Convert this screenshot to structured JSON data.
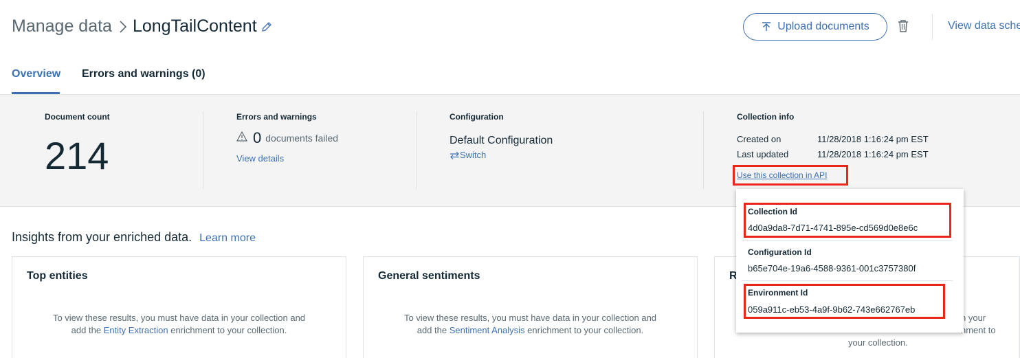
{
  "header": {
    "breadcrumb_root": "Manage data",
    "collection_name": "LongTailContent",
    "upload_label": "Upload documents",
    "view_schema_label": "View data sche"
  },
  "tabs": [
    {
      "label": "Overview",
      "active": true
    },
    {
      "label": "Errors and warnings (0)",
      "active": false
    }
  ],
  "summary": {
    "document_count_label": "Document count",
    "document_count": "214",
    "errors_label": "Errors and warnings",
    "errors_count": "0",
    "errors_text": "documents failed",
    "view_details": "View details",
    "configuration_label": "Configuration",
    "configuration_name": "Default Configuration",
    "switch_label": "Switch",
    "collection_info_label": "Collection info",
    "created_on_label": "Created on",
    "created_on": "11/28/2018 1:16:24 pm EST",
    "last_updated_label": "Last updated",
    "last_updated": "11/28/2018 1:16:24 pm EST",
    "api_link": "Use this collection in API"
  },
  "insights": {
    "title": "Insights from your enriched data.",
    "learn_more": "Learn more",
    "cards": [
      {
        "title": "Top entities",
        "pre": "To view these results, you must have data in your collection and add the ",
        "link": "Entity Extraction",
        "post": " enrichment to your collection."
      },
      {
        "title": "General sentiments",
        "pre": "To view these results, you must have data in your collection and add the ",
        "link": "Sentiment Analysis",
        "post": " enrichment to your collection."
      },
      {
        "title": "R",
        "pre": "",
        "link": "",
        "post": "n your",
        "line2": "nment to",
        "line3": "your collection."
      }
    ]
  },
  "popover": {
    "collection_id_label": "Collection Id",
    "collection_id": "4d0a9da8-7d71-4741-895e-cd569d0e8e6c",
    "configuration_id_label": "Configuration Id",
    "configuration_id": "b65e704e-19a6-4588-9361-001c3757380f",
    "environment_id_label": "Environment Id",
    "environment_id": "059a911c-eb53-4a9f-9b62-743e662767eb"
  },
  "colors": {
    "accent": "#3d70b2",
    "highlight": "#e8261a",
    "panel_bg": "#f4f4f4"
  },
  "icons": [
    "chevron-right-icon",
    "pencil-icon",
    "upload-icon",
    "trash-icon",
    "warning-icon",
    "switch-arrows-icon"
  ]
}
